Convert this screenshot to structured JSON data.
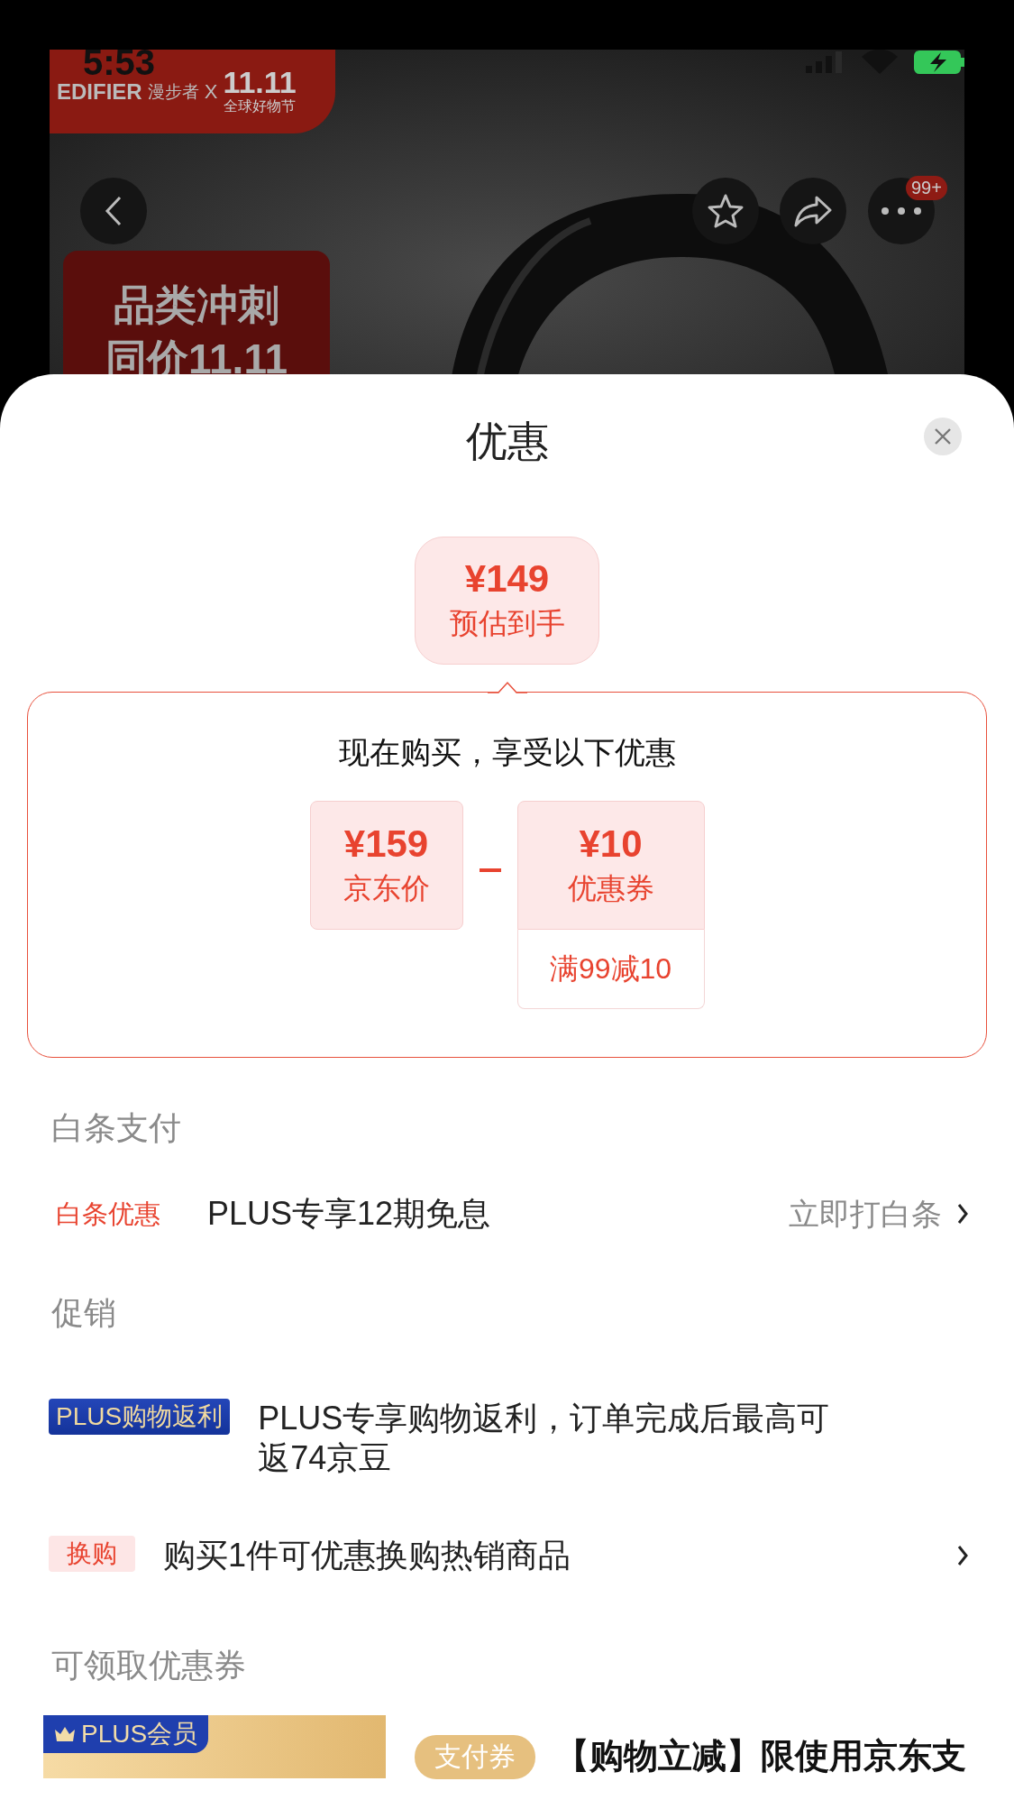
{
  "status_bar": {
    "time": "5:53"
  },
  "product_banner": {
    "brand": "EDIFIER",
    "brand_cn": "漫步者",
    "cross": "X",
    "event_logo": "11.11",
    "event_name": "全球好物节"
  },
  "promo_label": {
    "line_1": "品类冲刺",
    "line_2": "同价11.11"
  },
  "nav": {
    "badge": "99+"
  },
  "sheet": {
    "title": "优惠"
  },
  "estimate": {
    "price": "¥149",
    "label": "预估到手"
  },
  "breakdown": {
    "heading": "现在购买，享受以下优惠",
    "items": [
      {
        "kind": "price",
        "amount": "¥159",
        "label": "京东价"
      },
      {
        "kind": "coupon",
        "amount": "¥10",
        "label": "优惠券",
        "condition": "满99减10"
      }
    ]
  },
  "sections": [
    {
      "heading": "白条支付",
      "rows": [
        {
          "kind": "text_tag",
          "tag": "白条优惠",
          "text": "PLUS专享12期免息",
          "action": "立即打白条",
          "chevron": true
        }
      ]
    },
    {
      "heading": "促销",
      "rows": [
        {
          "kind": "plus_badge",
          "tag": "PLUS购物返利",
          "text": "PLUS专享购物返利，订单完成后最高可返74京豆",
          "chevron": false
        },
        {
          "kind": "pink_badge",
          "tag": "换购",
          "text": "购买1件可优惠换购热销商品",
          "chevron": true
        }
      ]
    },
    {
      "heading": "可领取优惠券",
      "coupons": [
        {
          "badge": "PLUS会员",
          "type": "支付券",
          "title": "【购物立减】限使用京东支"
        }
      ]
    }
  ]
}
